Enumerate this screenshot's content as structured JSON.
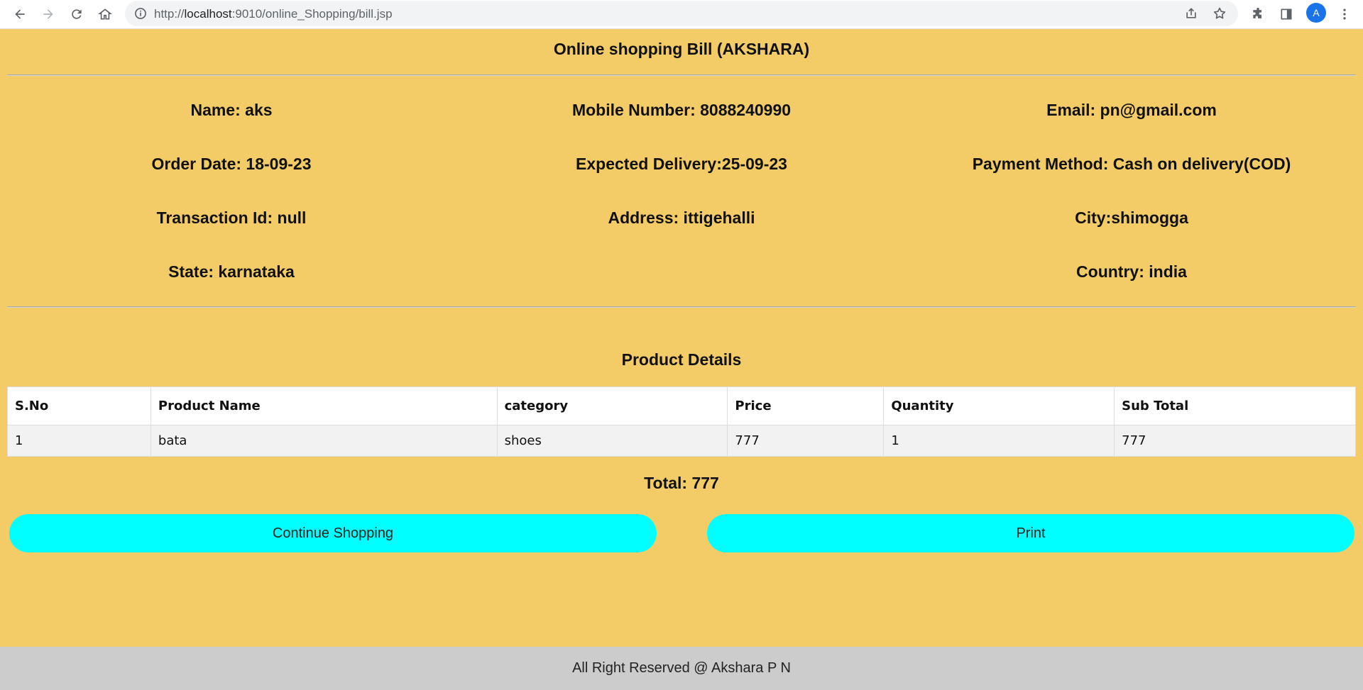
{
  "browser": {
    "url_prefix": "http://",
    "url_host": "localhost",
    "url_rest": ":9010/online_Shopping/bill.jsp",
    "avatar_letter": "A",
    "icons": [
      "back-icon",
      "forward-icon",
      "reload-icon",
      "home-icon",
      "site-info-icon",
      "share-icon",
      "star-icon",
      "extensions-icon",
      "side-panel-icon",
      "menu-icon"
    ]
  },
  "bill": {
    "title": "Online shopping Bill (AKSHARA)",
    "name": "Name: aks",
    "mobile": "Mobile Number: 8088240990",
    "email": "Email: pn@gmail.com",
    "order_date": "Order Date: 18-09-23",
    "expected_delivery": "Expected Delivery:25-09-23",
    "payment_method": "Payment Method: Cash on delivery(COD)",
    "transaction_id": "Transaction Id: null",
    "address": "Address: ittigehalli",
    "city": "City:shimogga",
    "state": "State: karnataka",
    "country": "Country: india"
  },
  "products": {
    "title": "Product Details",
    "headers": [
      "S.No",
      "Product Name",
      "category",
      "Price",
      "Quantity",
      "Sub Total"
    ],
    "rows": [
      [
        "1",
        "bata",
        "shoes",
        "777",
        "1",
        "777"
      ]
    ],
    "total": "Total: 777"
  },
  "actions": {
    "continue_label": "Continue Shopping",
    "print_label": "Print"
  },
  "footer": {
    "text": "All Right Reserved @ Akshara P N"
  },
  "colors": {
    "page_bg": "#f3cc67",
    "button_bg": "#00ffff",
    "footer_bg": "#cccccc"
  }
}
